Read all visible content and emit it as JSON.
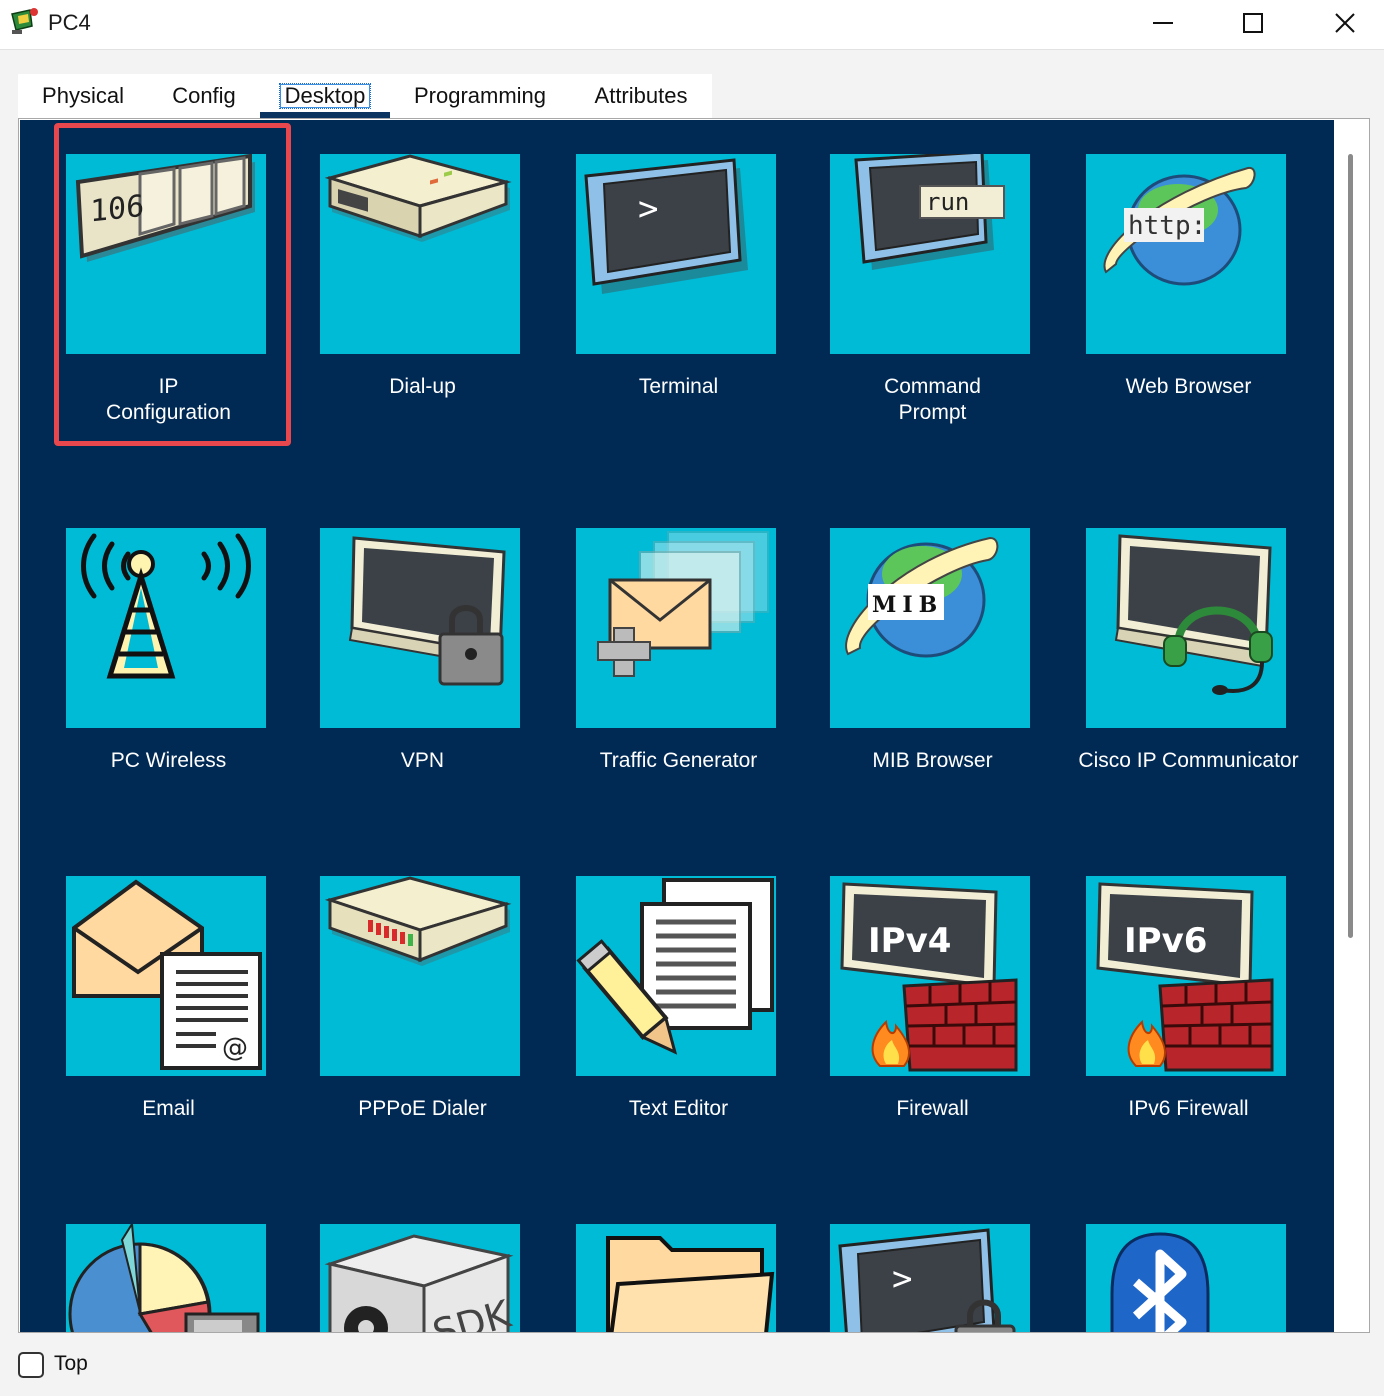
{
  "window": {
    "title": "PC4",
    "controls": {
      "minimize": "minimize-icon",
      "maximize": "maximize-icon",
      "close": "close-icon"
    }
  },
  "tabs": [
    {
      "label": "Physical",
      "active": false
    },
    {
      "label": "Config",
      "active": false
    },
    {
      "label": "Desktop",
      "active": true
    },
    {
      "label": "Programming",
      "active": false
    },
    {
      "label": "Attributes",
      "active": false
    }
  ],
  "colors": {
    "desktop_bg": "#002954",
    "tile_bg": "#00bbd6",
    "highlight": "#e8484d",
    "active_tab_underline": "#0b3460"
  },
  "desktop_apps": [
    {
      "label": "IP\nConfiguration",
      "icon": "ip-configuration-icon",
      "highlighted": true
    },
    {
      "label": "Dial-up",
      "icon": "dial-up-modem-icon"
    },
    {
      "label": "Terminal",
      "icon": "terminal-icon"
    },
    {
      "label": "Command\nPrompt",
      "icon": "command-prompt-icon"
    },
    {
      "label": "Web Browser",
      "icon": "web-browser-icon"
    },
    {
      "label": "PC Wireless",
      "icon": "wireless-tower-icon"
    },
    {
      "label": "VPN",
      "icon": "vpn-lock-icon"
    },
    {
      "label": "Traffic Generator",
      "icon": "traffic-generator-icon"
    },
    {
      "label": "MIB Browser",
      "icon": "mib-browser-icon"
    },
    {
      "label": "Cisco IP Communicator",
      "icon": "headset-monitor-icon"
    },
    {
      "label": "Email",
      "icon": "email-icon"
    },
    {
      "label": "PPPoE Dialer",
      "icon": "pppoe-modem-icon"
    },
    {
      "label": "Text Editor",
      "icon": "text-editor-icon"
    },
    {
      "label": "Firewall",
      "icon": "ipv4-firewall-icon",
      "icon_text": "IPv4"
    },
    {
      "label": "IPv6 Firewall",
      "icon": "ipv6-firewall-icon",
      "icon_text": "IPv6"
    },
    {
      "label": "",
      "icon": "pie-chart-icon"
    },
    {
      "label": "",
      "icon": "sdk-box-icon",
      "icon_text": "SDK"
    },
    {
      "label": "",
      "icon": "folder-icon"
    },
    {
      "label": "",
      "icon": "secure-terminal-icon"
    },
    {
      "label": "",
      "icon": "bluetooth-icon"
    }
  ],
  "icon_text": {
    "ip_config": "106",
    "run": "run",
    "http": "http:",
    "mib": "MIB",
    "terminal_prompt": ">",
    "ipv4": "IPv4",
    "ipv6": "IPv6",
    "sdk": "SDK"
  },
  "footer": {
    "top_label": "Top",
    "top_checked": false
  }
}
